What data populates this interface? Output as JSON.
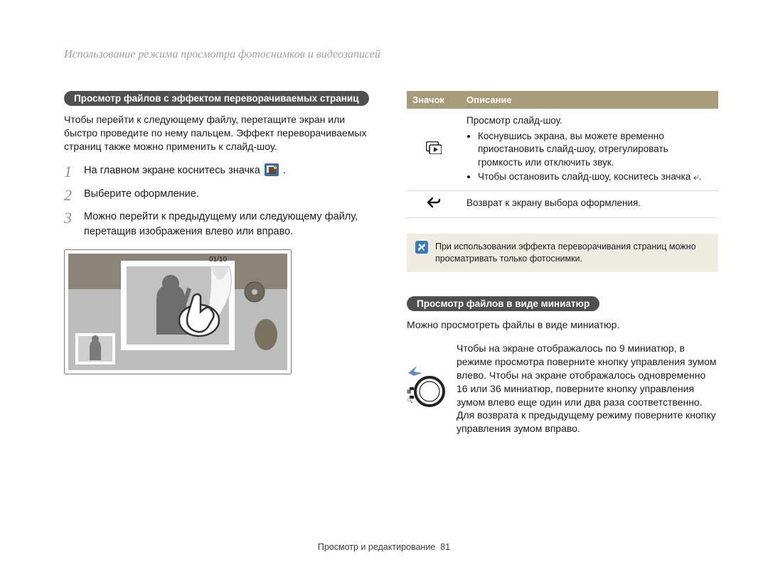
{
  "header": {
    "title": "Использование режима просмотра фотоснимков и видеозаписей"
  },
  "left": {
    "subhead": "Просмотр файлов с эффектом переворачиваемых страниц",
    "intro": "Чтобы перейти к следующему файлу, перетащите экран или быстро проведите по нему пальцем. Эффект переворачиваемых страниц также можно применить к слайд-шоу.",
    "steps": [
      {
        "num": "1",
        "text_before": "На главном экране коснитесь значка ",
        "text_after": "."
      },
      {
        "num": "2",
        "text": "Выберите оформление."
      },
      {
        "num": "3",
        "text": "Можно перейти к предыдущему или следующему файлу, перетащив изображения влево или вправо."
      }
    ],
    "screenshot_counter": "01/10"
  },
  "right": {
    "table": {
      "head_icon": "Значок",
      "head_desc": "Описание",
      "rows": [
        {
          "icon_name": "slideshow-icon",
          "desc_title": "Просмотр слайд-шоу.",
          "bullets": [
            "Коснувшись экрана, вы можете временно приостановить слайд-шоу, отрегулировать громкость или отключить звук.",
            "Чтобы остановить слайд-шоу, коснитесь значка ⤶."
          ]
        },
        {
          "icon_name": "back-icon",
          "desc": "Возврат к экрану выбора оформления."
        }
      ]
    },
    "note": "При использовании эффекта переворачивания страниц можно просматривать только фотоснимки.",
    "thumbs": {
      "subhead": "Просмотр файлов в виде миниатюр",
      "intro": "Можно просмотреть файлы в виде миниатюр.",
      "body": "Чтобы на экране отображалось по 9 миниатюр, в режиме просмотра поверните кнопку управления зумом влево. Чтобы на экране отображалось одновременно 16 или 36 миниатюр, поверните кнопку управления зумом влево еще один или два раза соответственно. Для возврата к предыдущему режиму поверните кнопку управления зумом вправо."
    }
  },
  "footer": {
    "section": "Просмотр и редактирование",
    "page": "81"
  }
}
